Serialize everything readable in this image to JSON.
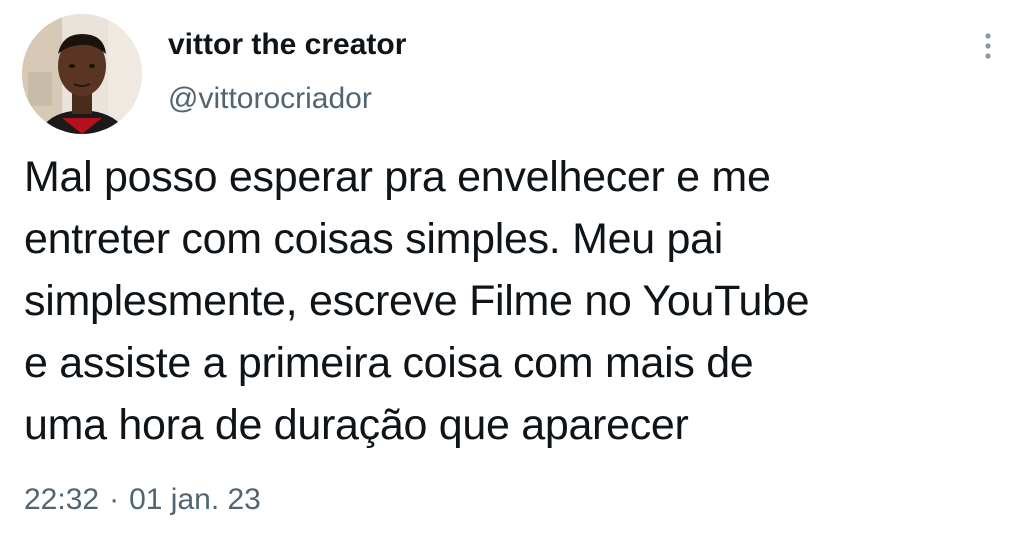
{
  "author": {
    "display_name": "vittor the creator",
    "handle": "@vittorocriador",
    "avatar_icon": "user-avatar-photo"
  },
  "tweet": {
    "text": "Mal posso esperar pra envelhecer e me\nentreter com coisas simples. Meu pai\nsimplesmente, escreve Filme no YouTube\ne assiste a primeira coisa com mais de\numa hora de duração que aparecer",
    "time": "22:32",
    "separator": "·",
    "date": "01 jan. 23"
  },
  "icons": {
    "more": "more-vertical-icon"
  },
  "colors": {
    "text": "#0f1419",
    "secondary": "#536471",
    "background": "#ffffff"
  }
}
